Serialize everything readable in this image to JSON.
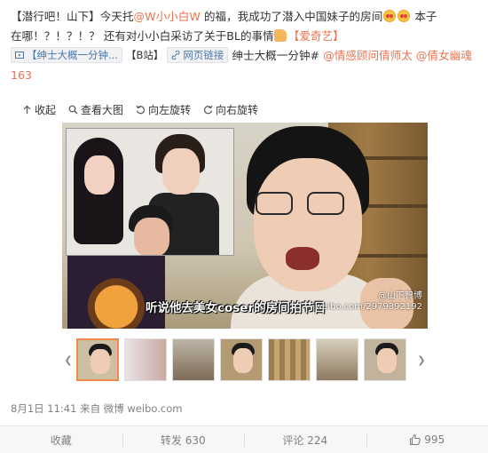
{
  "post": {
    "line1_a": "【潜行吧！山下】今天托",
    "mention1": "@W小小白W",
    "line1_b": " 的福，我成功了潜入中国妹子的房间",
    "line1_c": " 本子",
    "line2_a": "在哪！？！？！？ 还有对小小白采访了关于BL的事情",
    "hashtag_iqiyi": "【爱奇艺】",
    "chip1": "【绅士大概一分钟...",
    "chip2_text": "【B站】",
    "chip3": "网页链接",
    "line3_a": " 绅士大概一分钟#",
    "mention2": " @情感顾问倩师太",
    "mention3": " @倩女幽魂163"
  },
  "toolbar": {
    "collapse": "收起",
    "view_large": "查看大图",
    "rotate_left": "向左旋转",
    "rotate_right": "向右旋转"
  },
  "photo": {
    "subtitle": "听说他去美女coser的房间拍节目",
    "watermark_name": "@山下智博",
    "watermark_url": "weibo.com/2979392192"
  },
  "thumbnails": {
    "count": 8,
    "active_index": 0
  },
  "meta": {
    "time": "8月1日 11:41",
    "from_label": "来自",
    "source": "微博 weibo.com"
  },
  "actions": {
    "favorite": "收藏",
    "repost": "转发 630",
    "comment": "评论 224",
    "like": "995"
  },
  "colors": {
    "link": "#eb7350",
    "chip_text": "#4a78a8",
    "active_thumb_border": "#f08a4b"
  }
}
